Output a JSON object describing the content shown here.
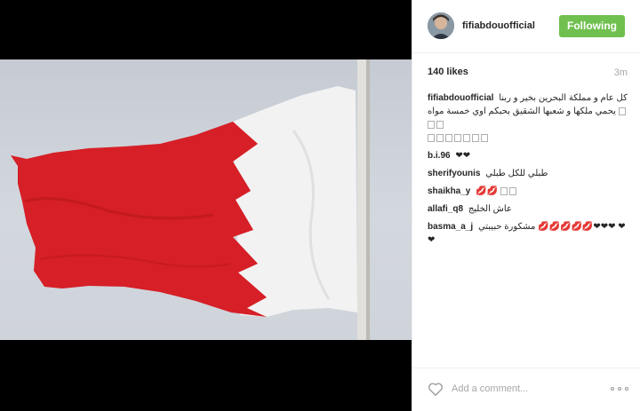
{
  "post": {
    "username": "fifiabdouofficial",
    "follow_label": "Following",
    "likes": "140 likes",
    "time": "3m",
    "caption": {
      "user": "fifiabdouofficial",
      "text": "كل عام و مملكة البحرين بخير و ربنا يحمي ملكها و شعبها الشقيق بحبكم اوي خمسة مواه"
    },
    "comments": [
      {
        "user": "b.i.96",
        "text": "❤❤"
      },
      {
        "user": "sherifyounis",
        "text": "طبلي للكل طبلي"
      },
      {
        "user": "shaikha_y",
        "text": "💋💋"
      },
      {
        "user": "allafi_q8",
        "text": "عاش الخليج"
      },
      {
        "user": "basma_a_j",
        "text": "مشكورة حبيبتي 💋💋💋💋💋❤❤❤ ❤❤"
      }
    ],
    "comment_placeholder": "Add a comment..."
  },
  "icons": {
    "like": "heart-outline-icon",
    "more": "more-options-icon"
  },
  "colors": {
    "follow_button": "#70c050",
    "flag_red": "#d9232a",
    "flag_white": "#f4f4f4"
  }
}
